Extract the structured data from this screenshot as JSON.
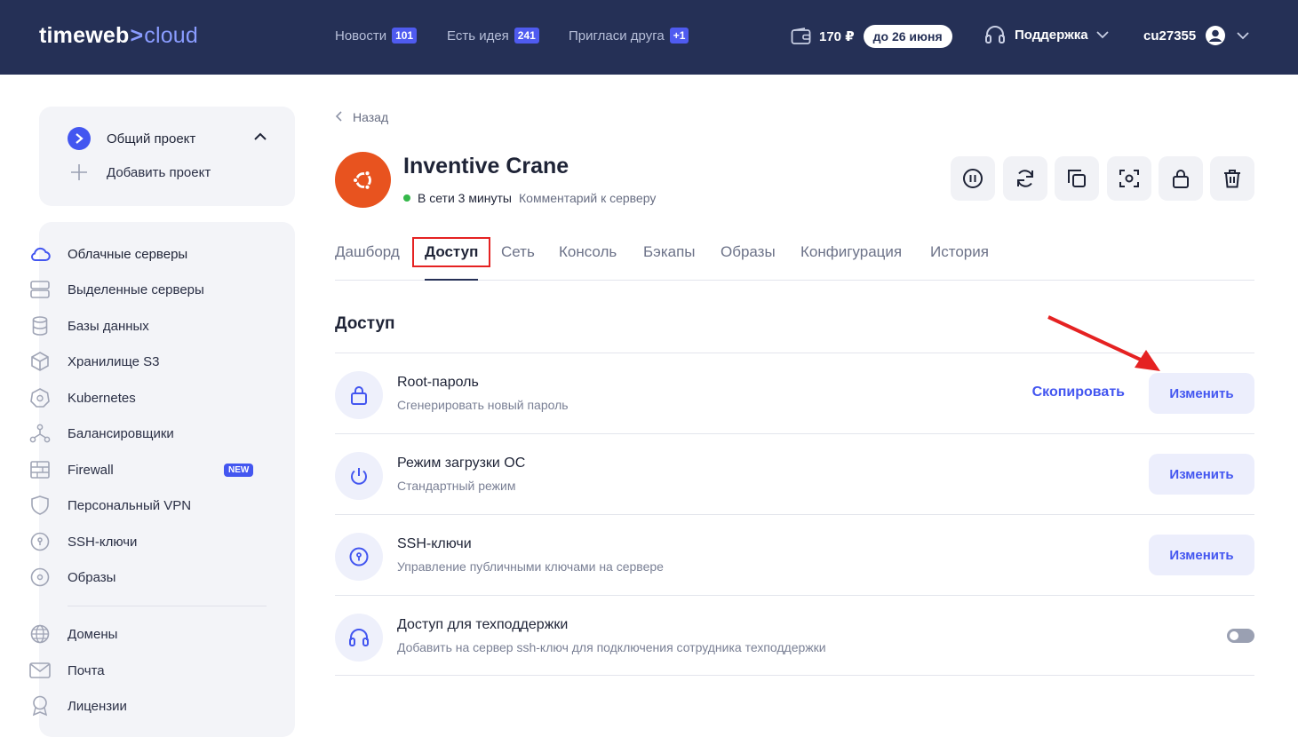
{
  "topbar": {
    "logo_main": "timeweb",
    "logo_sep": ">",
    "logo_cloud": "cloud",
    "links": [
      {
        "label": "Новости",
        "badge": "101"
      },
      {
        "label": "Есть идея",
        "badge": "241"
      },
      {
        "label": "Пригласи друга",
        "badge": "+1"
      }
    ],
    "balance": "170 ₽",
    "balance_until": "до 26 июня",
    "support": "Поддержка",
    "username": "cu27355"
  },
  "sidebar": {
    "project": "Общий проект",
    "add_project": "Добавить проект",
    "items": [
      {
        "label": "Облачные серверы",
        "icon": "cloud-icon"
      },
      {
        "label": "Выделенные серверы",
        "icon": "server-icon"
      },
      {
        "label": "Базы данных",
        "icon": "database-icon"
      },
      {
        "label": "Хранилище S3",
        "icon": "cube-icon"
      },
      {
        "label": "Kubernetes",
        "icon": "kubernetes-icon"
      },
      {
        "label": "Балансировщики",
        "icon": "balancer-icon"
      },
      {
        "label": "Firewall",
        "icon": "firewall-icon",
        "badge": "NEW"
      },
      {
        "label": "Персональный VPN",
        "icon": "shield-icon"
      },
      {
        "label": "SSH-ключи",
        "icon": "key-icon"
      },
      {
        "label": "Образы",
        "icon": "disc-icon"
      },
      {
        "label": "Домены",
        "icon": "globe-icon"
      },
      {
        "label": "Почта",
        "icon": "mail-icon"
      },
      {
        "label": "Лицензии",
        "icon": "award-icon"
      }
    ]
  },
  "main": {
    "back": "Назад",
    "server_name": "Inventive Crane",
    "status": "В сети 3 минуты",
    "comment": "Комментарий к серверу",
    "tabs": [
      "Дашборд",
      "Доступ",
      "Сеть",
      "Консоль",
      "Бэкапы",
      "Образы",
      "Конфигурация",
      "История"
    ],
    "active_tab": "Доступ",
    "section_title": "Доступ",
    "rows": [
      {
        "title": "Root-пароль",
        "subtitle": "Сгенерировать новый пароль",
        "copy": "Скопировать",
        "action": "Изменить"
      },
      {
        "title": "Режим загрузки ОС",
        "subtitle": "Стандартный режим",
        "action": "Изменить"
      },
      {
        "title": "SSH-ключи",
        "subtitle": "Управление публичными ключами на сервере",
        "action": "Изменить"
      },
      {
        "title": "Доступ для техподдержки",
        "subtitle": "Добавить на сервер ssh-ключ для подключения сотрудника техподдержки",
        "toggle": false
      }
    ]
  },
  "colors": {
    "topbar_bg": "#253056",
    "accent": "#4356f0",
    "ubuntu": "#e8531f",
    "status_online": "#35b84a",
    "annotation": "#e52222"
  }
}
